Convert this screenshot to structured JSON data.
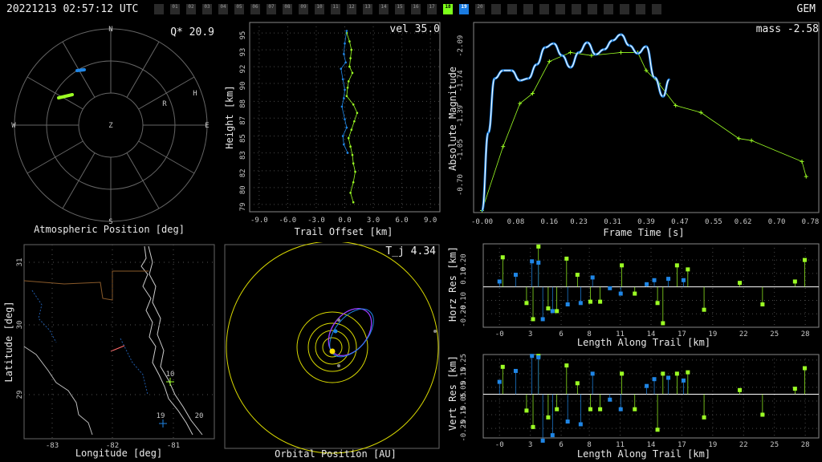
{
  "header": {
    "timestamp": "20221213 02:57:12 UTC",
    "shower": "GEM",
    "cameras": [
      {
        "label": "",
        "state": "off"
      },
      {
        "label": "01",
        "state": "off"
      },
      {
        "label": "02",
        "state": "off"
      },
      {
        "label": "03",
        "state": "off"
      },
      {
        "label": "04",
        "state": "off"
      },
      {
        "label": "05",
        "state": "off"
      },
      {
        "label": "06",
        "state": "off"
      },
      {
        "label": "07",
        "state": "off"
      },
      {
        "label": "08",
        "state": "off"
      },
      {
        "label": "09",
        "state": "off"
      },
      {
        "label": "10",
        "state": "off"
      },
      {
        "label": "11",
        "state": "off"
      },
      {
        "label": "12",
        "state": "off"
      },
      {
        "label": "13",
        "state": "off"
      },
      {
        "label": "14",
        "state": "off"
      },
      {
        "label": "15",
        "state": "off"
      },
      {
        "label": "16",
        "state": "off"
      },
      {
        "label": "17",
        "state": "off"
      },
      {
        "label": "18",
        "state": "green"
      },
      {
        "label": "19",
        "state": "blue"
      },
      {
        "label": "20",
        "state": "off"
      },
      {
        "label": "",
        "state": "off"
      },
      {
        "label": "",
        "state": "off"
      },
      {
        "label": "",
        "state": "off"
      },
      {
        "label": "",
        "state": "off"
      },
      {
        "label": "",
        "state": "off"
      },
      {
        "label": "",
        "state": "off"
      },
      {
        "label": "",
        "state": "off"
      },
      {
        "label": "",
        "state": "off"
      },
      {
        "label": "",
        "state": "off"
      },
      {
        "label": "",
        "state": "off"
      },
      {
        "label": "",
        "state": "off"
      }
    ]
  },
  "colors": {
    "green": "#9cff24",
    "blue": "#1f86e6",
    "white": "#ffffff",
    "yellow": "#d8d800",
    "purple": "#9a3cff",
    "grid": "#4a4a4a"
  },
  "panels": {
    "atmos": {
      "title": "Atmospheric Position [deg]",
      "q_label": "Q* 20.9",
      "dirs": {
        "n": "N",
        "s": "S",
        "e": "E",
        "w": "W",
        "z": "Z"
      },
      "station_labels": [
        "R",
        "H"
      ]
    },
    "height": {
      "title": "Trail Offset [km]",
      "ylabel": "Height [km]",
      "vel_label": "vel 35.0",
      "xticks": [
        "-9.0",
        "-6.0",
        "-3.0",
        "0.0",
        "3.0",
        "6.0",
        "9.0"
      ],
      "yticks": [
        "95",
        "93",
        "92",
        "90",
        "88",
        "87",
        "85",
        "83",
        "82",
        "80",
        "79"
      ]
    },
    "light": {
      "title": "Frame Time [s]",
      "ylabel": "Absolute Magnitude",
      "mass_label": "mass -2.58",
      "xticks": [
        "-0.00",
        "0.08",
        "0.16",
        "0.23",
        "0.31",
        "0.39",
        "0.47",
        "0.55",
        "0.62",
        "0.70",
        "0.78"
      ],
      "yticks": [
        "-2.09",
        "-1.74",
        "-1.39",
        "-1.05",
        "-0.70"
      ]
    },
    "map": {
      "title": "Longitude [deg]",
      "ylabel": "Latitude [deg]",
      "xticks": [
        "-83",
        "-82",
        "-81"
      ],
      "yticks": [
        "31",
        "30",
        "29"
      ],
      "station_labels": [
        "10",
        "19",
        "20"
      ]
    },
    "orbit": {
      "title": "Orbital Position [AU]",
      "tj_label": "T_j 4.34"
    },
    "horz": {
      "title": "Length Along Trail [km]",
      "ylabel": "Horz Res [km]",
      "yticks": [
        "0.20",
        "0.10",
        "-0.10",
        "-0.20"
      ],
      "xticks": [
        "-0",
        "3",
        "6",
        "8",
        "11",
        "14",
        "17",
        "19",
        "22",
        "25",
        "28"
      ]
    },
    "vert": {
      "title": "Length Along Trail [km]",
      "ylabel": "Vert Res [km]",
      "yticks": [
        "0.25",
        "0.15",
        "0.05",
        "-0.05",
        "-0.15",
        "-0.25"
      ],
      "xticks": [
        "-0",
        "3",
        "6",
        "8",
        "11",
        "14",
        "17",
        "19",
        "22",
        "25",
        "28"
      ]
    }
  },
  "chart_data": [
    {
      "type": "scatter",
      "name": "height-offset",
      "xlabel": "Trail Offset [km]",
      "ylabel": "Height [km]",
      "xlim": [
        -10,
        10
      ],
      "ylim": [
        78.2,
        96.2
      ],
      "series": [
        {
          "color": "green",
          "x": [
            0.2,
            0.5,
            0.7,
            0.6,
            0.5,
            0.8,
            0.4,
            0.3,
            0.2,
            0.9,
            1.3,
            1.0,
            0.7,
            0.4,
            0.6,
            0.8,
            0.9,
            1.1,
            0.9,
            0.6,
            0.9
          ],
          "y": [
            95.2,
            94.4,
            93.6,
            92.8,
            92.0,
            91.4,
            90.6,
            90.0,
            89.2,
            88.4,
            87.6,
            86.8,
            86.0,
            85.2,
            84.4,
            83.6,
            82.8,
            82.0,
            81.0,
            80.0,
            79.1
          ]
        },
        {
          "color": "blue",
          "x": [
            0.2,
            0.0,
            -0.1,
            0.1,
            -0.4,
            -0.2,
            0.0,
            -0.1,
            -0.3,
            0.0,
            0.2,
            -0.2,
            -0.1,
            0.3
          ],
          "y": [
            95.4,
            94.2,
            93.2,
            92.4,
            91.8,
            90.8,
            89.8,
            89.0,
            88.2,
            87.0,
            86.2,
            85.4,
            84.6,
            83.8
          ]
        }
      ]
    },
    {
      "type": "line",
      "name": "light-curve",
      "xlabel": "Frame Time [s]",
      "ylabel": "Absolute Magnitude",
      "xlim": [
        -0.02,
        0.8
      ],
      "ylim": [
        -0.4,
        -2.3
      ],
      "series": [
        {
          "color": "green",
          "x": [
            0.0,
            0.05,
            0.09,
            0.12,
            0.16,
            0.21,
            0.26,
            0.33,
            0.37,
            0.39,
            0.42,
            0.46,
            0.52,
            0.61,
            0.64,
            0.76,
            0.77
          ],
          "y": [
            -0.42,
            -1.06,
            -1.49,
            -1.59,
            -1.91,
            -2.0,
            -1.97,
            -2.0,
            -2.0,
            -1.82,
            -1.69,
            -1.47,
            -1.4,
            -1.14,
            -1.12,
            -0.91,
            -0.76
          ]
        },
        {
          "color": "blue",
          "x": [
            0.0,
            0.015,
            0.03,
            0.05,
            0.07,
            0.09,
            0.11,
            0.13,
            0.15,
            0.17,
            0.19,
            0.21,
            0.23,
            0.25,
            0.27,
            0.29,
            0.31,
            0.33,
            0.35,
            0.37,
            0.39,
            0.41,
            0.43,
            0.445
          ],
          "y": [
            -0.42,
            -1.2,
            -1.74,
            -1.82,
            -1.82,
            -1.72,
            -1.74,
            -1.88,
            -2.05,
            -2.09,
            -1.97,
            -1.85,
            -2.0,
            -2.1,
            -1.98,
            -2.03,
            -2.12,
            -2.18,
            -2.07,
            -1.99,
            -2.06,
            -1.75,
            -1.56,
            -1.73
          ]
        }
      ]
    },
    {
      "type": "bar",
      "name": "horz-residuals",
      "xlabel": "Length Along Trail [km]",
      "ylabel": "Horz Res [km]",
      "ylim": [
        -0.3,
        0.32
      ],
      "series": [
        {
          "color": "green",
          "x": [
            0.3,
            2.5,
            3.1,
            3.6,
            4.5,
            5.3,
            6.2,
            7.2,
            8.4,
            9.3,
            11.3,
            12.5,
            14.6,
            15.1,
            16.4,
            17.4,
            18.9,
            22.2,
            24.3,
            27.3,
            28.2
          ],
          "y": [
            0.22,
            -0.12,
            -0.24,
            0.3,
            -0.16,
            -0.18,
            0.21,
            0.09,
            -0.11,
            -0.11,
            0.16,
            -0.05,
            -0.12,
            -0.27,
            0.16,
            0.13,
            -0.17,
            0.03,
            -0.13,
            0.04,
            0.2
          ],
          "dir": "mixed"
        },
        {
          "color": "blue",
          "x": [
            0.0,
            1.5,
            3.0,
            3.6,
            4.0,
            4.9,
            6.3,
            7.5,
            8.6,
            10.2,
            11.2,
            13.6,
            14.3,
            15.6,
            17.0
          ],
          "y": [
            0.04,
            0.09,
            0.19,
            0.18,
            -0.24,
            -0.18,
            -0.13,
            -0.12,
            0.07,
            -0.01,
            -0.05,
            0.02,
            0.05,
            0.06,
            0.05
          ]
        }
      ]
    },
    {
      "type": "bar",
      "name": "vert-residuals",
      "xlabel": "Length Along Trail [km]",
      "ylabel": "Vert Res [km]",
      "ylim": [
        -0.32,
        0.29
      ],
      "series": [
        {
          "color": "green",
          "x": [
            0.3,
            2.5,
            3.1,
            3.6,
            4.5,
            5.3,
            6.2,
            7.2,
            8.4,
            9.3,
            11.3,
            12.5,
            14.6,
            15.1,
            16.4,
            17.4,
            18.9,
            22.2,
            24.3,
            27.3,
            28.2
          ],
          "y": [
            0.2,
            -0.12,
            -0.24,
            0.28,
            -0.17,
            -0.11,
            0.21,
            0.08,
            -0.11,
            -0.11,
            0.15,
            -0.11,
            -0.26,
            0.15,
            0.15,
            0.16,
            -0.17,
            0.03,
            -0.15,
            0.04,
            0.19
          ]
        },
        {
          "color": "blue",
          "x": [
            0.0,
            1.5,
            3.0,
            3.6,
            4.0,
            4.9,
            6.3,
            7.5,
            8.6,
            10.2,
            11.2,
            13.6,
            14.3,
            15.6,
            17.0
          ],
          "y": [
            0.09,
            0.17,
            0.28,
            0.27,
            -0.34,
            -0.3,
            -0.2,
            -0.22,
            0.15,
            -0.04,
            -0.11,
            0.06,
            0.11,
            0.12,
            0.1
          ]
        }
      ]
    }
  ]
}
